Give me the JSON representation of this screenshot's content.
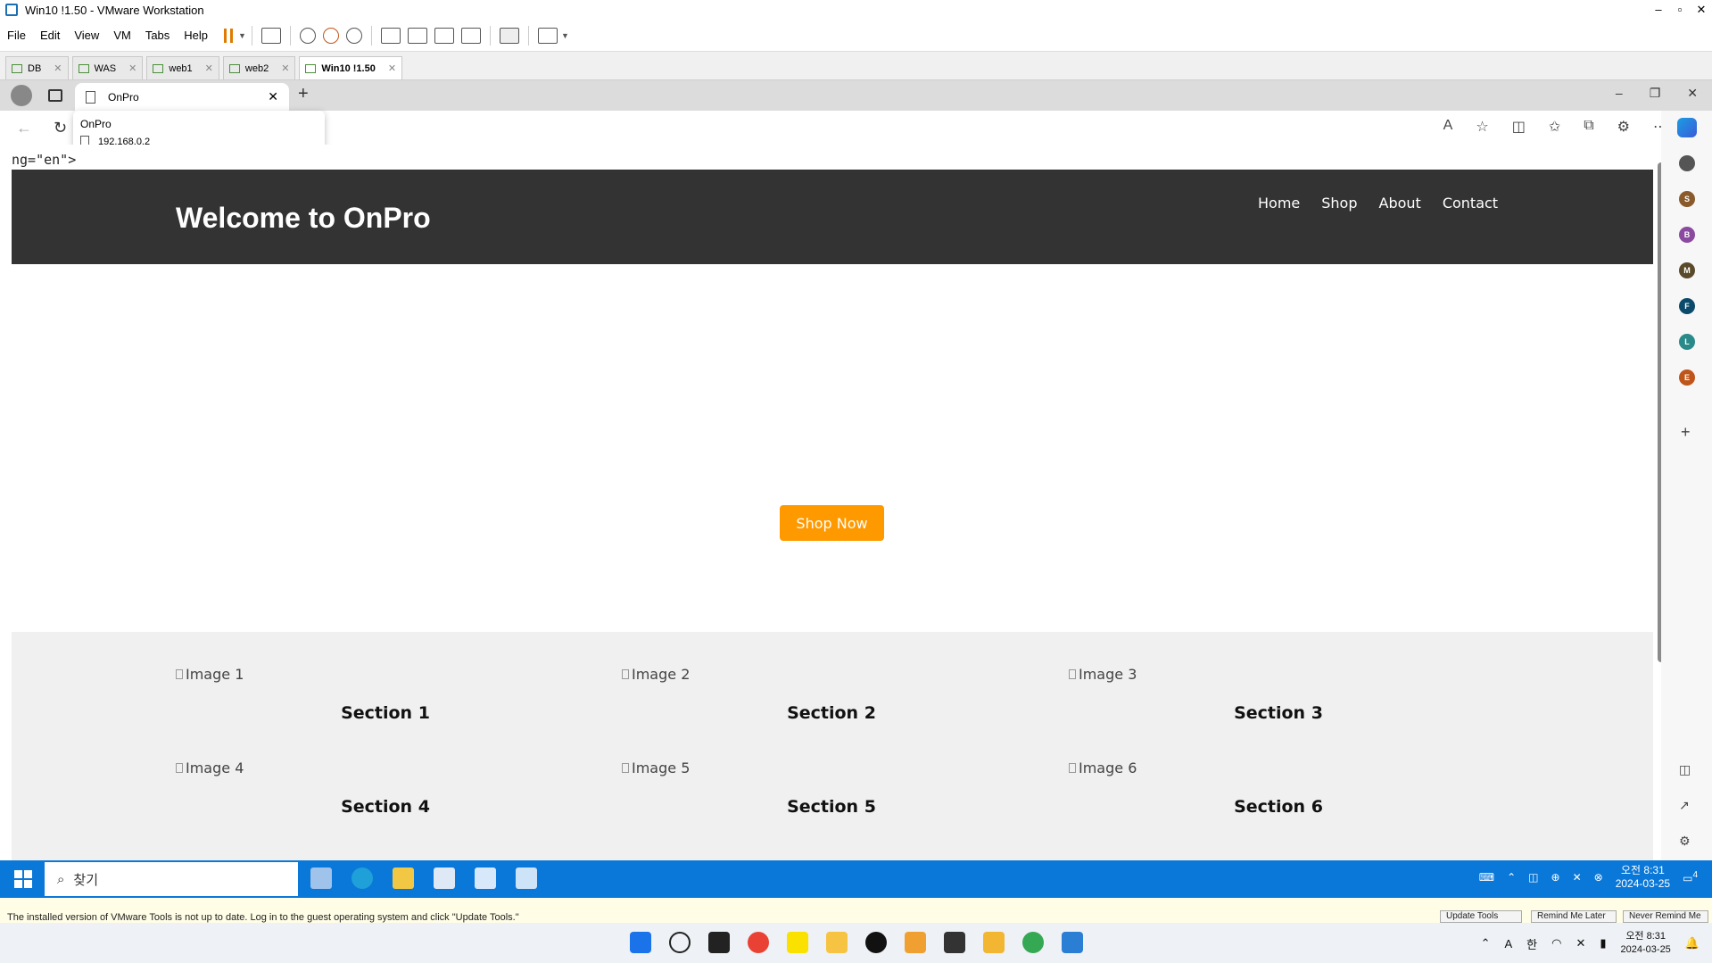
{
  "vmware": {
    "title": "Win10 !1.50 - VMware Workstation",
    "menu": [
      "File",
      "Edit",
      "View",
      "VM",
      "Tabs",
      "Help"
    ],
    "tabs": [
      {
        "label": "DB",
        "active": false
      },
      {
        "label": "WAS",
        "active": false
      },
      {
        "label": "web1",
        "active": false
      },
      {
        "label": "web2",
        "active": false
      },
      {
        "label": "Win10 !1.50",
        "active": true
      }
    ]
  },
  "browser": {
    "tab_title": "OnPro",
    "popup_title": "OnPro",
    "popup_url": "192.168.0.2",
    "stray_text": "ng=\"en\">",
    "sidebar_avatars": [
      {
        "letter": "",
        "color": "#555555"
      },
      {
        "letter": "S",
        "color": "#8a5a2b"
      },
      {
        "letter": "B",
        "color": "#8a4aa0"
      },
      {
        "letter": "M",
        "color": "#5a4a2a"
      },
      {
        "letter": "F",
        "color": "#0b4a6a"
      },
      {
        "letter": "L",
        "color": "#2a8a8a"
      },
      {
        "letter": "E",
        "color": "#c0551a"
      }
    ]
  },
  "site": {
    "title": "Welcome to OnPro",
    "nav": [
      "Home",
      "Shop",
      "About",
      "Contact"
    ],
    "hero_button": "Shop Now",
    "sections": [
      {
        "image_alt": "Image 1",
        "title": "Section 1"
      },
      {
        "image_alt": "Image 2",
        "title": "Section 2"
      },
      {
        "image_alt": "Image 3",
        "title": "Section 3"
      },
      {
        "image_alt": "Image 4",
        "title": "Section 4"
      },
      {
        "image_alt": "Image 5",
        "title": "Section 5"
      },
      {
        "image_alt": "Image 6",
        "title": "Section 6"
      }
    ],
    "colors": {
      "header_bg": "#333333",
      "button_bg": "#ff9900",
      "sections_bg": "#f0f0f0"
    }
  },
  "guest_taskbar": {
    "search_placeholder": "찾기",
    "time": "오전 8:31",
    "date": "2024-03-25",
    "notification_count": "4"
  },
  "notice": {
    "text": "The installed version of VMware Tools is not up to date. Log in to the guest operating system and click \"Update Tools.\"",
    "buttons": [
      "Update Tools",
      "Remind Me Later",
      "Never Remind Me"
    ]
  },
  "host_taskbar": {
    "ime": "A",
    "lang": "한",
    "time": "오전 8:31",
    "date": "2024-03-25"
  }
}
